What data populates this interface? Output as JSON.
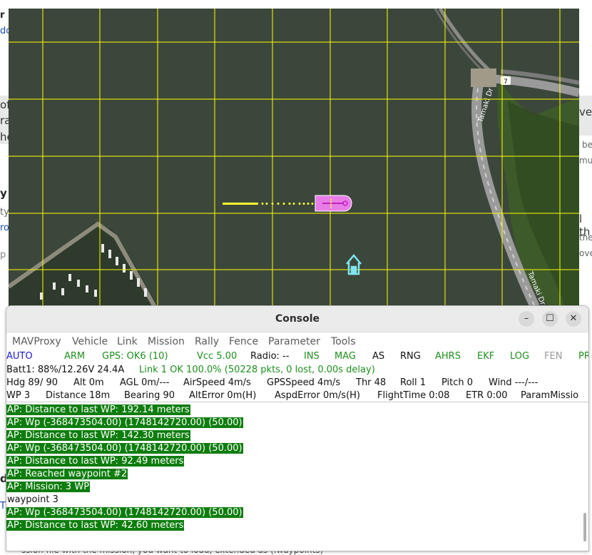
{
  "background_fragments": {
    "l1": "r",
    "l2": "do",
    "l3": "of",
    "l4": "ra",
    "l5": "he",
    "l6": "y",
    "l7": "ty",
    "l8": "ro",
    "l9": "p",
    "l10": "d",
    "l11": "T",
    "r1": "vel",
    "r2": "be",
    "r3": "mu",
    "r4": "l th",
    "r5": "the",
    "r6": "ove",
    "bottom": "ssion file with the mission, you want to load, extended as (.waypoints)"
  },
  "map": {
    "grid_color": "#ffff00",
    "vehicle_color": "#e87de8",
    "home_icon": "home-icon"
  },
  "console": {
    "title": "Console",
    "buttons": {
      "minimize": "–",
      "maximize": "☐",
      "close": "✕"
    },
    "menu": [
      "MAVProxy",
      "Vehicle",
      "Link",
      "Mission",
      "Rally",
      "Fence",
      "Parameter",
      "Tools"
    ],
    "status_row1": [
      {
        "text": "AUTO",
        "color": "blue"
      },
      {
        "text": "ARM",
        "color": "green"
      },
      {
        "text": "GPS: OK6 (10)",
        "color": "green"
      },
      {
        "text": "Vcc 5.00",
        "color": "green"
      },
      {
        "text": "Radio: --",
        "color": "black"
      },
      {
        "text": "INS",
        "color": "green"
      },
      {
        "text": "MAG",
        "color": "green"
      },
      {
        "text": "AS",
        "color": "black"
      },
      {
        "text": "RNG",
        "color": "black"
      },
      {
        "text": "AHRS",
        "color": "green"
      },
      {
        "text": "EKF",
        "color": "green"
      },
      {
        "text": "LOG",
        "color": "green"
      },
      {
        "text": "FEN",
        "color": "gray"
      },
      {
        "text": "PRE",
        "color": "green"
      }
    ],
    "status_row2": [
      {
        "text": "Batt1: 88%/12.26V 24.4A",
        "color": "black"
      },
      {
        "text": "Link 1 OK 100.0% (50228 pkts, 0 lost, 0.00s delay)",
        "color": "green"
      }
    ],
    "status_row3": [
      {
        "text": "Hdg 89/ 90",
        "color": "black"
      },
      {
        "text": "Alt 0m",
        "color": "black"
      },
      {
        "text": "AGL 0m/---",
        "color": "black"
      },
      {
        "text": "AirSpeed 4m/s",
        "color": "black"
      },
      {
        "text": "GPSSpeed 4m/s",
        "color": "black"
      },
      {
        "text": "Thr 48",
        "color": "black"
      },
      {
        "text": "Roll 1",
        "color": "black"
      },
      {
        "text": "Pitch 0",
        "color": "black"
      },
      {
        "text": "Wind ---/---",
        "color": "black"
      }
    ],
    "status_row4": [
      {
        "text": "WP 3",
        "color": "black"
      },
      {
        "text": "Distance 18m",
        "color": "black"
      },
      {
        "text": "Bearing 90",
        "color": "black"
      },
      {
        "text": "AltError 0m(H)",
        "color": "black"
      },
      {
        "text": "AspdError 0m/s(H)",
        "color": "black"
      },
      {
        "text": "FlightTime 0:08",
        "color": "black"
      },
      {
        "text": "ETR 0:00",
        "color": "black"
      },
      {
        "text": "ParamMissio",
        "color": "black"
      }
    ],
    "log": [
      {
        "text": "AP: Distance to last WP: 192.14 meters",
        "highlight": true
      },
      {
        "text": "AP: Wp (-368473504.00) (1748142720.00) (50.00)",
        "highlight": true
      },
      {
        "text": "AP: Distance to last WP: 142.30 meters",
        "highlight": true
      },
      {
        "text": "AP: Wp (-368473504.00) (1748142720.00) (50.00)",
        "highlight": true
      },
      {
        "text": "AP: Distance to last WP: 92.49 meters",
        "highlight": true
      },
      {
        "text": "AP: Reached waypoint #2",
        "highlight": true
      },
      {
        "text": "AP: Mission: 3 WP",
        "highlight": true
      },
      {
        "text": "waypoint 3",
        "highlight": false
      },
      {
        "text": "AP: Wp (-368473504.00) (1748142720.00) (50.00)",
        "highlight": true
      },
      {
        "text": "AP: Distance to last WP: 42.60 meters",
        "highlight": true
      }
    ]
  }
}
